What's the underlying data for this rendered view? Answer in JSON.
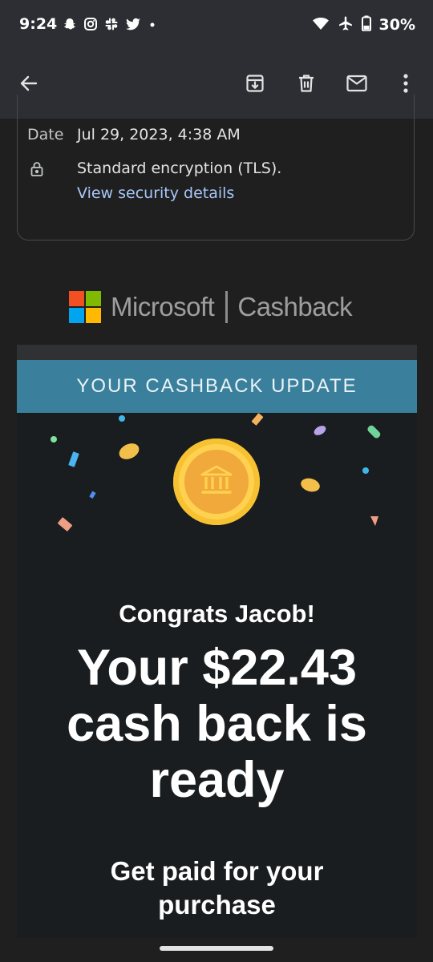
{
  "status_bar": {
    "time": "9:24",
    "battery": "30%",
    "left_icons": [
      "snapchat-icon",
      "instagram-icon",
      "slack-icon",
      "twitter-icon",
      "dot-icon"
    ],
    "right_icons": [
      "wifi-icon",
      "airplane-icon",
      "battery-icon"
    ]
  },
  "toolbar": {
    "icons": [
      "back-arrow-icon",
      "archive-icon",
      "delete-icon",
      "mail-icon",
      "more-vert-icon"
    ]
  },
  "details": {
    "date_label": "Date",
    "date_value": "Jul 29, 2023, 4:38 AM",
    "encryption": "Standard encryption (TLS).",
    "security_link": "View security details"
  },
  "brand": {
    "company": "Microsoft",
    "product": "Cashback"
  },
  "email": {
    "banner": "YOUR CASHBACK UPDATE",
    "greeting": "Congrats Jacob!",
    "headline_lines": [
      "Your $22.43",
      "cash back is",
      "ready"
    ],
    "sub_lines": [
      "Get paid for your",
      "purchase"
    ]
  },
  "colors": {
    "banner": "#3a809c",
    "coin": "#ffd150",
    "link": "#a8c7fa",
    "ms_red": "#f25022",
    "ms_green": "#7fba00",
    "ms_blue": "#00a4ef",
    "ms_yellow": "#ffb900"
  }
}
